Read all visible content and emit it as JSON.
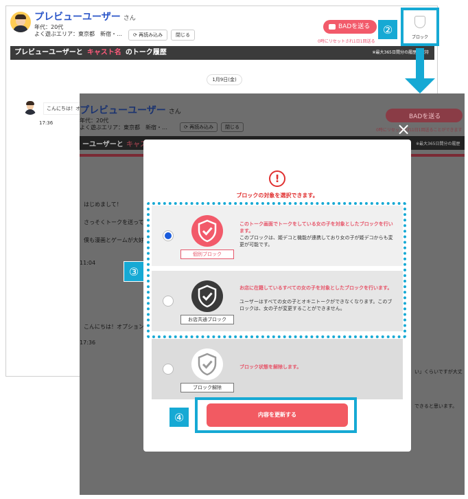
{
  "back": {
    "user_name": "プレビューユーザー",
    "honorific": "さん",
    "age": "年代：20代",
    "area": "よく遊ぶエリア：東京都　新宿・…",
    "reload_label": "再読み込み",
    "close_label": "閉じる",
    "bad_label": "BADを送る",
    "bad_note": "0時にリセットされ1日1回送る",
    "block_label": "ブロック",
    "history_pre": "プレビューユーザーと",
    "history_cast": "キャスト名",
    "history_post": "のトーク履歴",
    "history_note": "※最大365日間分の履歴が保持",
    "date_pill": "1月9日(金)",
    "msg_hello": "こんにちは！オ",
    "msg_time": "17:36"
  },
  "front": {
    "user_name": "プレビューユーザー",
    "honorific": "さん",
    "age": "年代：20代",
    "area": "よく遊ぶエリア：東京都　新宿・…",
    "reload_label": "再読み込み",
    "close_label": "閉じる",
    "bad_label": "BADを送る",
    "bad_note": "0時にリセットされ1日1回送ることができます",
    "history_frag_a": "ーユーザーと",
    "history_frag_b": "キャス",
    "history_note": "※最大365日間分の履歴",
    "messages": [
      "はじめまして！",
      "さっそくトークを送って",
      "僕も漫画とゲームが大好",
      "11:04",
      "こんにちは！オプション",
      "17:36"
    ],
    "right_frag_1": "い」くらいですが大丈",
    "right_frag_2": "できると思います。"
  },
  "modal": {
    "close_icon": "×",
    "warn_icon": "!",
    "title": "ブロックの対象を選択できます。",
    "options": [
      {
        "label": "個別ブロック",
        "head": "このトーク画面でトークをしている女の子を対象としたブロックを行います。",
        "body": "このブロックは、姫デコと機能が連携しており女の子が姫デコからも変更が可能です。",
        "selected": true,
        "color": "#f25a6a"
      },
      {
        "label": "お店共通ブロック",
        "head": "お店に在籍しているすべての女の子を対象としたブロックを行います。",
        "body": "ユーザーはすべての女の子とオキニトークができなくなります。このブロックは、女の子が変更することができません。",
        "selected": false,
        "color": "#3a3a3a"
      },
      {
        "label": "ブロック解除",
        "head": "ブロック状態を解除します。",
        "body": "",
        "selected": false,
        "color": "#ffffff"
      }
    ],
    "update_label": "内容を更新する"
  },
  "steps": {
    "s2": "②",
    "s3": "③",
    "s4": "④"
  },
  "colors": {
    "accent": "#16a9d4",
    "brand_pink": "#f25a6a",
    "selected_radio": "#1a5bdc"
  }
}
